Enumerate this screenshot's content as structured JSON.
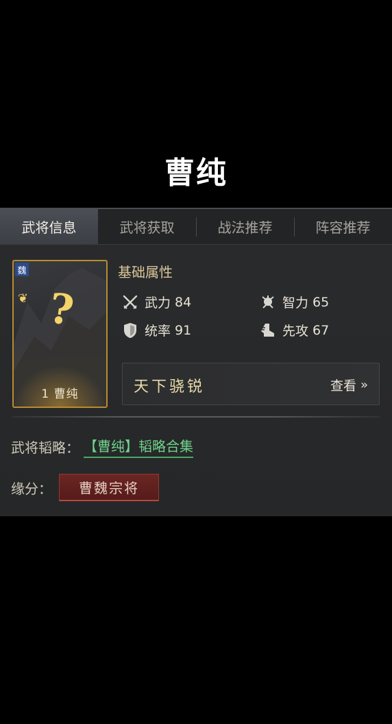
{
  "header": {
    "title": "曹纯"
  },
  "tabs": [
    {
      "label": "武将信息",
      "active": true
    },
    {
      "label": "武将获取",
      "active": false
    },
    {
      "label": "战法推荐",
      "active": false
    },
    {
      "label": "阵容推荐",
      "active": false
    }
  ],
  "card": {
    "faction": "魏",
    "portrait_placeholder": "?",
    "name": "1 曹纯"
  },
  "attributes": {
    "title": "基础属性",
    "stats": [
      {
        "icon": "crossed-swords-icon",
        "label": "武力",
        "value": "84"
      },
      {
        "icon": "intelligence-icon",
        "label": "智力",
        "value": "65"
      },
      {
        "icon": "shield-icon",
        "label": "统率",
        "value": "91"
      },
      {
        "icon": "boot-icon",
        "label": "先攻",
        "value": "67"
      }
    ]
  },
  "trait": {
    "name": "天下骁锐",
    "view_label": "查看",
    "view_chevron": "»"
  },
  "strategy": {
    "label": "武将韬略：",
    "link": "【曹纯】韬略合集"
  },
  "fate": {
    "label": "缘分：",
    "badge": "曹魏宗将"
  },
  "colors": {
    "gold_border": "#b88d30",
    "link_green": "#6fd38c",
    "fate_red": "#6b2623",
    "section_title": "#d9c79a"
  }
}
